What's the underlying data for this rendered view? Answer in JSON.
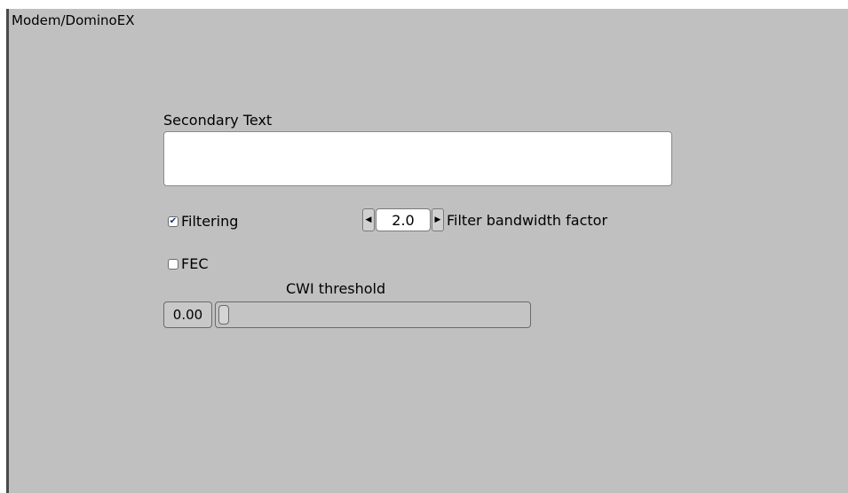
{
  "panel": {
    "title": "Modem/DominoEX"
  },
  "secondary_text": {
    "label": "Secondary Text",
    "value": ""
  },
  "filtering": {
    "label": "Filtering",
    "checked": true,
    "check_glyph": "✔"
  },
  "bandwidth": {
    "value": "2.0",
    "label": "Filter bandwidth factor",
    "dec_glyph": "◀",
    "inc_glyph": "▶"
  },
  "fec": {
    "label": "FEC",
    "checked": false
  },
  "cwi": {
    "label": "CWI threshold",
    "value": "0.00",
    "slider_fraction": 0.0
  }
}
